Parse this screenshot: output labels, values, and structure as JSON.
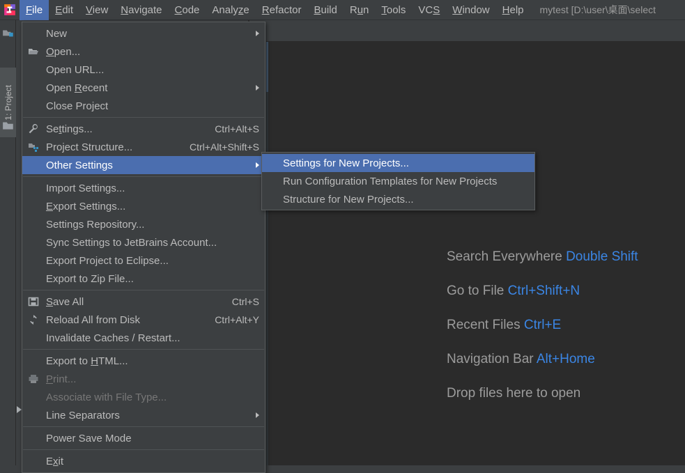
{
  "window": {
    "app_logo": "intellij-idea-logo",
    "project_title": "mytest [D:\\user\\桌面\\select"
  },
  "menubar": {
    "items": [
      {
        "label": "File",
        "mnemonic": "F",
        "active": true
      },
      {
        "label": "Edit",
        "mnemonic": "E",
        "active": false
      },
      {
        "label": "View",
        "mnemonic": "V",
        "active": false
      },
      {
        "label": "Navigate",
        "mnemonic": "N",
        "active": false
      },
      {
        "label": "Code",
        "mnemonic": "C",
        "active": false
      },
      {
        "label": "Analyze",
        "mnemonic": "z",
        "active": false
      },
      {
        "label": "Refactor",
        "mnemonic": "R",
        "active": false
      },
      {
        "label": "Build",
        "mnemonic": "B",
        "active": false
      },
      {
        "label": "Run",
        "mnemonic": "u",
        "active": false
      },
      {
        "label": "Tools",
        "mnemonic": "T",
        "active": false
      },
      {
        "label": "VCS",
        "mnemonic": "S",
        "active": false
      },
      {
        "label": "Window",
        "mnemonic": "W",
        "active": false
      },
      {
        "label": "Help",
        "mnemonic": "H",
        "active": false
      }
    ]
  },
  "sidebar": {
    "tool_window_label": "1: Project",
    "icons": [
      "project-folder-icon",
      "folder-icon"
    ]
  },
  "file_menu": {
    "items": [
      {
        "label": "New",
        "icon": null,
        "accel": "",
        "arrow": true,
        "selected": false,
        "disabled": false
      },
      {
        "label": "Open...",
        "icon": "open-folder-icon",
        "accel": "",
        "arrow": false,
        "selected": false,
        "disabled": false
      },
      {
        "label": "Open URL...",
        "icon": null,
        "accel": "",
        "arrow": false,
        "selected": false,
        "disabled": false
      },
      {
        "label": "Open Recent",
        "icon": null,
        "accel": "",
        "arrow": true,
        "selected": false,
        "disabled": false
      },
      {
        "label": "Close Project",
        "icon": null,
        "accel": "",
        "arrow": false,
        "selected": false,
        "disabled": false
      },
      {
        "separator": true
      },
      {
        "label": "Settings...",
        "icon": "wrench-icon",
        "accel": "Ctrl+Alt+S",
        "arrow": false,
        "selected": false,
        "disabled": false
      },
      {
        "label": "Project Structure...",
        "icon": "module-icon",
        "accel": "Ctrl+Alt+Shift+S",
        "arrow": false,
        "selected": false,
        "disabled": false
      },
      {
        "label": "Other Settings",
        "icon": null,
        "accel": "",
        "arrow": true,
        "selected": true,
        "disabled": false
      },
      {
        "separator": true
      },
      {
        "label": "Import Settings...",
        "icon": null,
        "accel": "",
        "arrow": false,
        "selected": false,
        "disabled": false
      },
      {
        "label": "Export Settings...",
        "icon": null,
        "accel": "",
        "arrow": false,
        "selected": false,
        "disabled": false
      },
      {
        "label": "Settings Repository...",
        "icon": null,
        "accel": "",
        "arrow": false,
        "selected": false,
        "disabled": false
      },
      {
        "label": "Sync Settings to JetBrains Account...",
        "icon": null,
        "accel": "",
        "arrow": false,
        "selected": false,
        "disabled": false
      },
      {
        "label": "Export Project to Eclipse...",
        "icon": null,
        "accel": "",
        "arrow": false,
        "selected": false,
        "disabled": false
      },
      {
        "label": "Export to Zip File...",
        "icon": null,
        "accel": "",
        "arrow": false,
        "selected": false,
        "disabled": false
      },
      {
        "separator": true
      },
      {
        "label": "Save All",
        "icon": "save-icon",
        "accel": "Ctrl+S",
        "arrow": false,
        "selected": false,
        "disabled": false
      },
      {
        "label": "Reload All from Disk",
        "icon": "reload-icon",
        "accel": "Ctrl+Alt+Y",
        "arrow": false,
        "selected": false,
        "disabled": false
      },
      {
        "label": "Invalidate Caches / Restart...",
        "icon": null,
        "accel": "",
        "arrow": false,
        "selected": false,
        "disabled": false
      },
      {
        "separator": true
      },
      {
        "label": "Export to HTML...",
        "icon": null,
        "accel": "",
        "arrow": false,
        "selected": false,
        "disabled": false
      },
      {
        "label": "Print...",
        "icon": "printer-icon",
        "accel": "",
        "arrow": false,
        "selected": false,
        "disabled": true
      },
      {
        "label": "Associate with File Type...",
        "icon": null,
        "accel": "",
        "arrow": false,
        "selected": false,
        "disabled": true
      },
      {
        "label": "Line Separators",
        "icon": null,
        "accel": "",
        "arrow": true,
        "selected": false,
        "disabled": false
      },
      {
        "separator": true
      },
      {
        "label": "Power Save Mode",
        "icon": null,
        "accel": "",
        "arrow": false,
        "selected": false,
        "disabled": false
      },
      {
        "separator": true
      },
      {
        "label": "Exit",
        "icon": null,
        "accel": "",
        "arrow": false,
        "selected": false,
        "disabled": false
      }
    ]
  },
  "other_settings_submenu": {
    "items": [
      {
        "label": "Settings for New Projects...",
        "selected": true
      },
      {
        "label": "Run Configuration Templates for New Projects",
        "selected": false
      },
      {
        "label": "Structure for New Projects...",
        "selected": false
      }
    ]
  },
  "editor_hints": {
    "rows": [
      {
        "action": "Search Everywhere",
        "shortcut": "Double Shift"
      },
      {
        "action": "Go to File",
        "shortcut": "Ctrl+Shift+N"
      },
      {
        "action": "Recent Files",
        "shortcut": "Ctrl+E"
      },
      {
        "action": "Navigation Bar",
        "shortcut": "Alt+Home"
      },
      {
        "action": "Drop files here to open",
        "shortcut": ""
      }
    ]
  },
  "colors": {
    "menu_background": "#3C3F41",
    "editor_background": "#2B2B2B",
    "selection_blue": "#4B6EAF",
    "shortcut_blue": "#3B86E5",
    "text": "#BBBBBB",
    "disabled_text": "#777777"
  }
}
